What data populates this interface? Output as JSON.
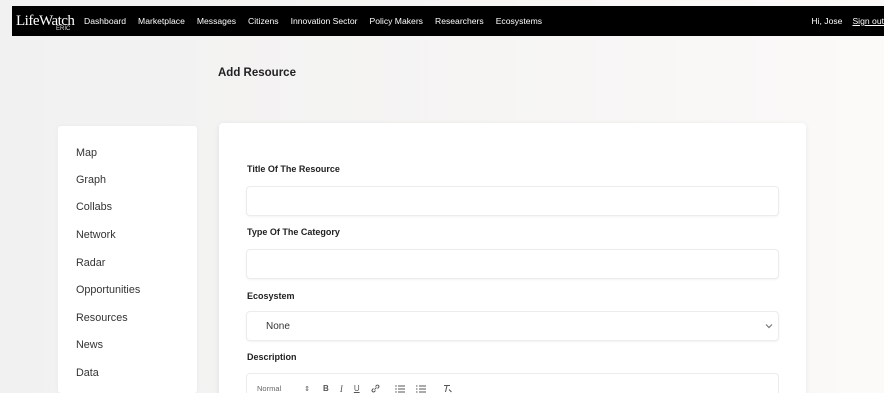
{
  "brand": {
    "logo_text": "LifeWatch",
    "logo_sub": "ERIC"
  },
  "nav": {
    "links": [
      "Dashboard",
      "Marketplace",
      "Messages",
      "Citizens",
      "Innovation Sector",
      "Policy Makers",
      "Researchers",
      "Ecosystems"
    ],
    "greeting": "Hi, Jose",
    "signout": "Sign out"
  },
  "page": {
    "title": "Add Resource"
  },
  "sidebar": {
    "items": [
      "Map",
      "Graph",
      "Collabs",
      "Network",
      "Radar",
      "Opportunities",
      "Resources",
      "News",
      "Data"
    ]
  },
  "form": {
    "title_label": "Title Of The Resource",
    "title_value": "",
    "category_label": "Type Of The Category",
    "category_value": "",
    "ecosystem_label": "Ecosystem",
    "ecosystem_value": "None",
    "description_label": "Description",
    "toolbar": {
      "format_select": "Normal",
      "bold": "B",
      "italic": "I",
      "underline": "U",
      "sort_glyph": "⇕",
      "link_glyph": "🔗",
      "ordered_list_glyph": "☰",
      "bullet_list_glyph": "≡",
      "clear_format_glyph": "T̸"
    }
  },
  "icons": {
    "chevron": "chevron-down-icon",
    "link": "link-icon",
    "ordered_list": "ordered-list-icon",
    "bullet_list": "bullet-list-icon",
    "clear_format": "clear-format-icon"
  }
}
